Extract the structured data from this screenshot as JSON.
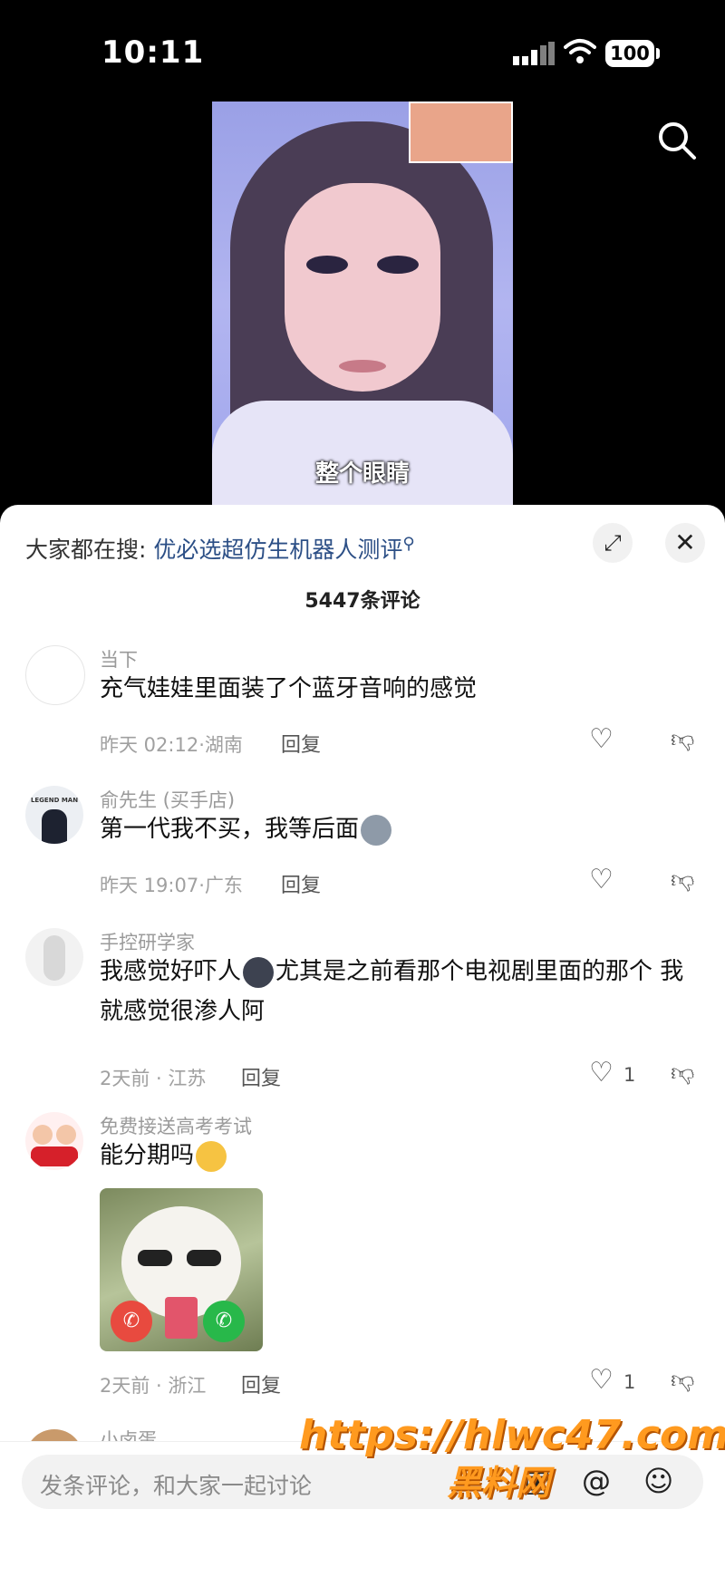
{
  "status": {
    "time": "10:11",
    "battery": "100"
  },
  "video": {
    "subtitle": "整个眼睛"
  },
  "search_suggest": {
    "prefix": "大家都在搜:",
    "term": "优必选超仿生机器人测评"
  },
  "comment_count": "5447条评论",
  "comments": [
    {
      "username": "当下",
      "text": "充气娃娃里面装了个蓝牙音响的感觉",
      "meta": "昨天 02:12·湖南",
      "reply": "回复",
      "likes": ""
    },
    {
      "username": "俞先生 (买手店)",
      "text": "第一代我不买，我等后面",
      "meta": "昨天 19:07·广东",
      "reply": "回复",
      "likes": "",
      "avatar_text": "LEGEND MAN"
    },
    {
      "username": "手控研学家",
      "text_a": "我感觉好吓人",
      "text_b": "尤其是之前看那个电视剧里面的那个 我就感觉很渗人阿",
      "meta": "2天前 · 江苏",
      "reply": "回复",
      "likes": "1"
    },
    {
      "username": "免费接送高考考试",
      "text": "能分期吗",
      "meta": "2天前 · 浙江",
      "reply": "回复",
      "likes": "1"
    },
    {
      "username": "小卤蛋"
    }
  ],
  "input": {
    "placeholder": "发条评论，和大家一起讨论"
  },
  "watermark": {
    "line1": "https://hlwc47.com",
    "line2": "黑料网"
  },
  "icons": {
    "search": "search-icon",
    "expand": "expand-icon",
    "close": "close-icon",
    "like": "heart-icon",
    "dislike": "thumbs-down-icon",
    "image": "image-icon",
    "mention": "at-icon",
    "emoji": "emoji-icon"
  }
}
